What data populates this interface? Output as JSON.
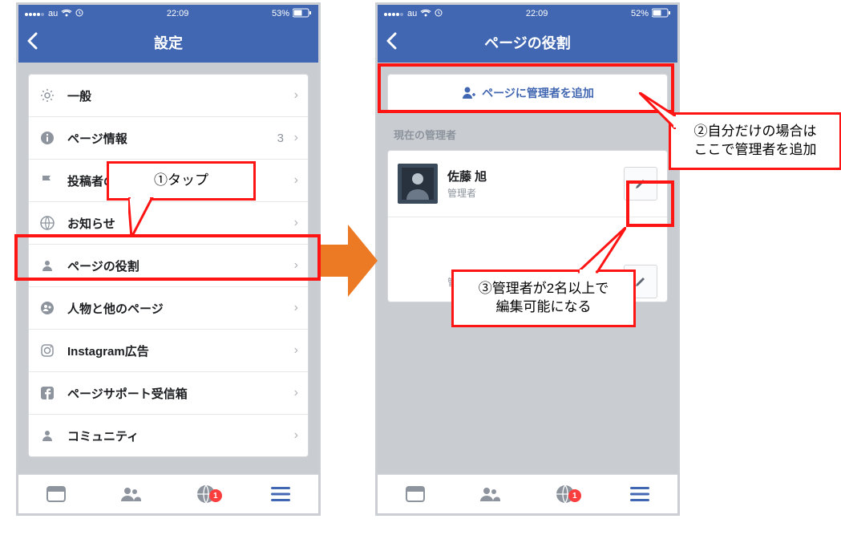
{
  "statusbar": {
    "carrier": "au",
    "time": "22:09",
    "battery_left": "53%",
    "battery_right": "52%"
  },
  "phone_left": {
    "title": "設定",
    "rows": [
      {
        "icon": "gear",
        "label": "一般"
      },
      {
        "icon": "info",
        "label": "ページ情報",
        "badge": "3"
      },
      {
        "icon": "flag",
        "label": "投稿者の"
      },
      {
        "icon": "globe",
        "label": "お知らせ"
      },
      {
        "icon": "person",
        "label": "ページの役割"
      },
      {
        "icon": "people",
        "label": "人物と他のページ"
      },
      {
        "icon": "camera",
        "label": "Instagram広告"
      },
      {
        "icon": "fb",
        "label": "ページサポート受信箱"
      },
      {
        "icon": "person",
        "label": "コミュニティ"
      }
    ]
  },
  "phone_right": {
    "title": "ページの役割",
    "add_admin_label": "ページに管理者を追加",
    "section_title": "現在の管理者",
    "admins": [
      {
        "name": "佐藤 旭",
        "role": "管理者"
      },
      {
        "name": "",
        "role": "管理者"
      }
    ]
  },
  "tabbar": {
    "notif_badge": "1"
  },
  "callouts": {
    "c1": "①タップ",
    "c2_line1": "②自分だけの場合は",
    "c2_line2": "ここで管理者を追加",
    "c3_line1": "③管理者が2名以上で",
    "c3_line2": "編集可能になる"
  }
}
